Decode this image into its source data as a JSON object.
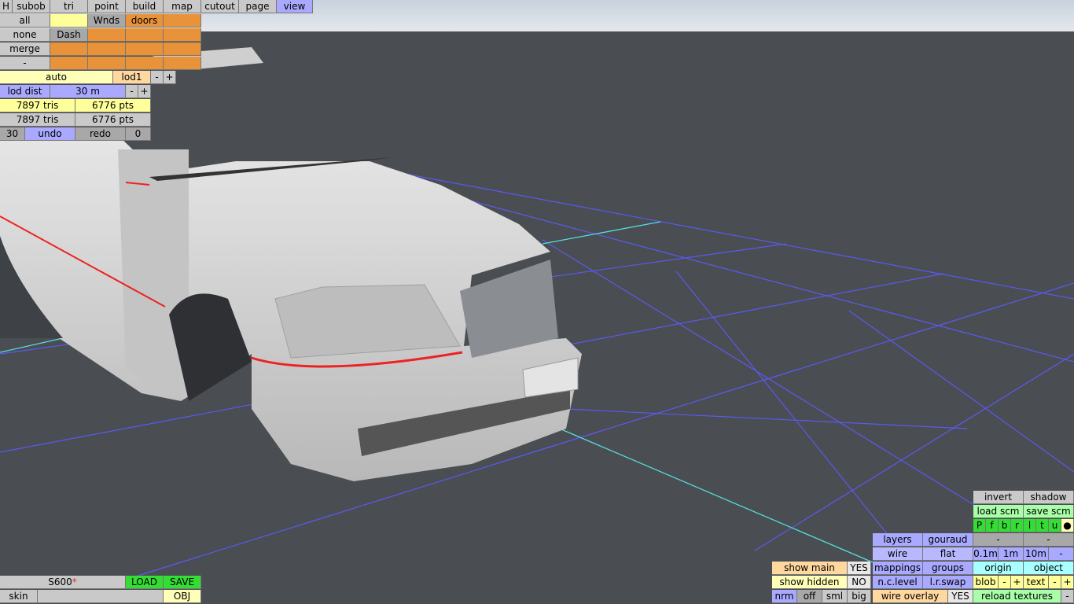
{
  "menu": {
    "h": "H",
    "tabs": [
      "subob",
      "tri",
      "point",
      "build",
      "map",
      "cutout",
      "page",
      "view"
    ],
    "active": "view"
  },
  "subobjects": {
    "all": "all",
    "none": "none",
    "merge": "merge",
    "dash_btn": "-",
    "wnds": "Wnds",
    "doors": "doors",
    "dash": "Dash"
  },
  "lod": {
    "auto": "auto",
    "lod1": "lod1",
    "minus": "-",
    "plus": "+",
    "dist_label": "lod dist",
    "dist_value": "30 m",
    "tris1": "7897 tris",
    "pts1": "6776 pts",
    "tris2": "7897 tris",
    "pts2": "6776 pts"
  },
  "history": {
    "count": "30",
    "undo": "undo",
    "redo": "redo",
    "redo_count": "0"
  },
  "file": {
    "name": "S600",
    "modified": "*",
    "load": "LOAD",
    "save": "SAVE",
    "skin": "skin",
    "obj": "OBJ"
  },
  "show": {
    "main": "show main",
    "main_value": "YES",
    "hidden": "show hidden",
    "hidden_value": "NO",
    "nrm": "nrm",
    "off": "off",
    "sml": "sml",
    "big": "big"
  },
  "render": {
    "layers": "layers",
    "gouraud": "gouraud",
    "wire": "wire",
    "flat": "flat",
    "mappings": "mappings",
    "groups": "groups",
    "nclevel": "n.c.level",
    "lrswap": "l.r.swap",
    "wire_overlay": "wire overlay",
    "wire_overlay_value": "YES"
  },
  "right": {
    "invert": "invert",
    "shadow": "shadow",
    "load_scm": "load scm",
    "save_scm": "save scm",
    "views": [
      "P",
      "f",
      "b",
      "r",
      "l",
      "t",
      "u",
      "●"
    ],
    "dash1": "-",
    "dash2": "-",
    "grid": [
      "0.1m",
      "1m",
      "10m",
      "-"
    ],
    "origin": "origin",
    "object": "object",
    "blob": "blob",
    "text": "text",
    "minus": "-",
    "plus": "+",
    "reload": "reload textures",
    "reload_minus": "-"
  },
  "colors": {
    "sky": "#d4dce4",
    "floor": "#4a4d52",
    "grid": "#5555ee",
    "axis": "#55dddd",
    "body": "#d8d8d8",
    "trim": "#ee2222"
  }
}
